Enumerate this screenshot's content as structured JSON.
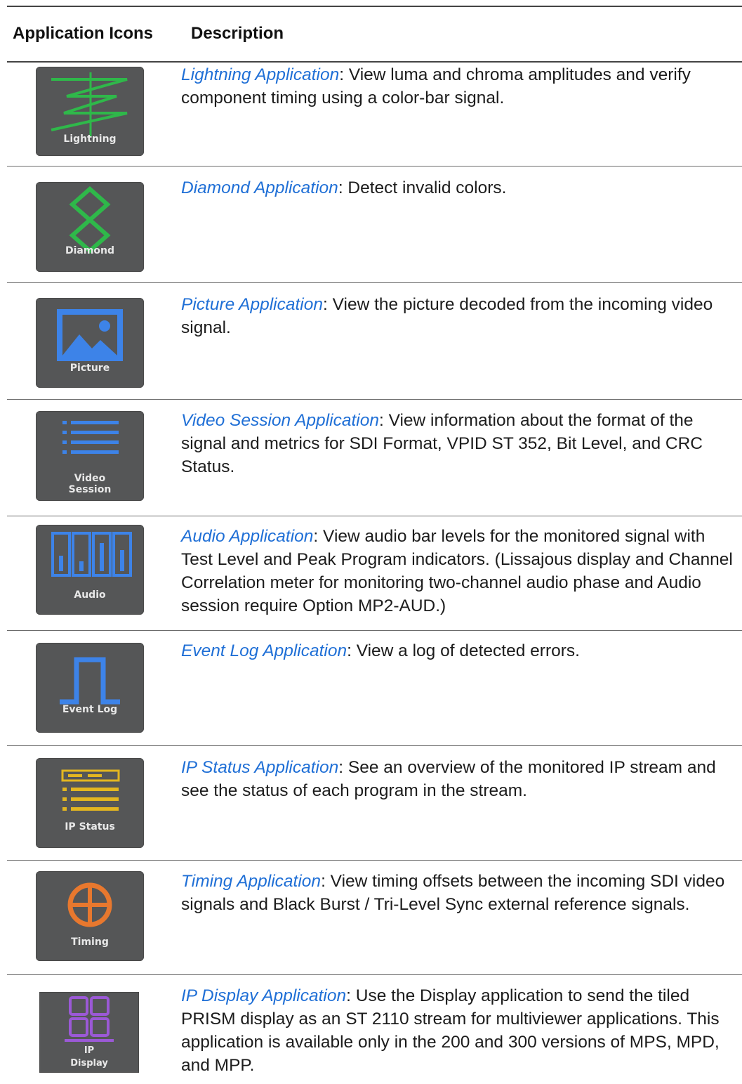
{
  "header": {
    "col_icons": "Application Icons",
    "col_description": "Description"
  },
  "rows": [
    {
      "icon_name": "lightning-icon",
      "icon_label": "Lightning",
      "icon_color": "#2fb84a",
      "link": "Lightning Application",
      "sep": ":",
      "text": " View luma and chroma amplitudes and verify component timing using a color-bar signal."
    },
    {
      "icon_name": "diamond-icon",
      "icon_label": "Diamond",
      "icon_color": "#2fb84a",
      "link": "Diamond Application",
      "sep": ":",
      "text": " Detect invalid colors."
    },
    {
      "icon_name": "picture-icon",
      "icon_label": "Picture",
      "icon_color": "#3d83e8",
      "link": "Picture Application",
      "sep": ":",
      "text": " View the picture decoded from the incoming video signal."
    },
    {
      "icon_name": "video-session-icon",
      "icon_label_line1": "Video",
      "icon_label_line2": "Session",
      "icon_color": "#3d83e8",
      "link": "Video Session Application",
      "sep": ":",
      "text": " View information about the format of the signal and metrics for SDI Format, VPID ST 352, Bit Level, and CRC Status."
    },
    {
      "icon_name": "audio-icon",
      "icon_label": "Audio",
      "icon_color": "#3d83e8",
      "link": "Audio Application",
      "sep": ":",
      "text": " View audio bar levels for the monitored signal with Test Level and Peak Program indicators. (Lissajous display and Channel Correlation meter for monitoring two-channel audio phase and Audio session require Option MP2-AUD.)"
    },
    {
      "icon_name": "event-log-icon",
      "icon_label": "Event Log",
      "icon_color": "#3d83e8",
      "link": "Event Log Application",
      "sep": ":",
      "text": " View a log of detected errors."
    },
    {
      "icon_name": "ip-status-icon",
      "icon_label": "IP Status",
      "icon_color": "#e3b620",
      "link": "IP Status Application",
      "sep": ":",
      "text": " See an overview of the monitored IP stream and see the status of each program in the stream."
    },
    {
      "icon_name": "timing-icon",
      "icon_label": "Timing",
      "icon_color": "#e8782e",
      "link": "Timing Application",
      "sep": ":",
      "text": " View timing offsets between the incoming SDI video signals and Black Burst / Tri-Level Sync external reference signals."
    },
    {
      "icon_name": "ip-display-icon",
      "icon_label_line1": "IP",
      "icon_label_line2": "Display",
      "icon_color": "#9b59d6",
      "link": "IP Display Application",
      "sep": ":",
      "text": " Use the Display application to send the tiled PRISM display as an ST 2110 stream for multiviewer applications. This application is available only in the 200 and 300 versions of MPS, MPD, and MPP."
    }
  ],
  "colors": {
    "link": "#1f6fd6",
    "icon_bg": "#555657",
    "rule": "#6b6b6b"
  }
}
